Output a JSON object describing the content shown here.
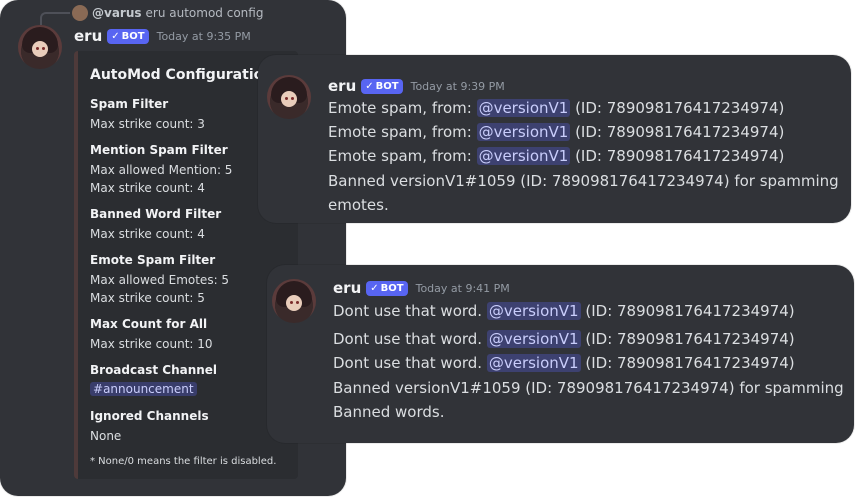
{
  "config_message": {
    "reply": {
      "user": "@varus",
      "text": "eru automod config"
    },
    "author": "eru",
    "bot_badge": "BOT",
    "timestamp": "Today at 9:35 PM",
    "embed": {
      "title": "AutoMod Configuration",
      "fields": [
        {
          "name": "Spam Filter",
          "values": [
            "Max strike count: 3"
          ]
        },
        {
          "name": "Mention Spam Filter",
          "values": [
            "Max allowed Mention: 5",
            "Max strike count: 4"
          ]
        },
        {
          "name": "Banned Word Filter",
          "values": [
            "Max strike count: 4"
          ]
        },
        {
          "name": "Emote Spam Filter",
          "values": [
            "Max allowed Emotes: 5",
            "Max strike count: 5"
          ]
        },
        {
          "name": "Max Count for All",
          "values": [
            "Max strike count: 10"
          ]
        },
        {
          "name": "Broadcast Channel",
          "channel": "announcement"
        },
        {
          "name": "Ignored Channels",
          "values": [
            "None"
          ]
        }
      ],
      "footer": "* None/0 means the filter is disabled."
    }
  },
  "emote_message": {
    "author": "eru",
    "bot_badge": "BOT",
    "timestamp": "Today at 9:39 PM",
    "lines": [
      {
        "prefix": "Emote spam, from: ",
        "mention": "@versionV1",
        "suffix": " (ID: 789098176417234974)"
      },
      {
        "prefix": "Emote spam, from: ",
        "mention": "@versionV1",
        "suffix": " (ID: 789098176417234974)"
      },
      {
        "prefix": "Emote spam, from: ",
        "mention": "@versionV1",
        "suffix": " (ID: 789098176417234974)"
      }
    ],
    "ban_line1": "Banned versionV1#1059 (ID: 789098176417234974) for spamming",
    "ban_line2": "emotes."
  },
  "word_message": {
    "author": "eru",
    "bot_badge": "BOT",
    "timestamp": "Today at 9:41 PM",
    "lines": [
      {
        "prefix": "Dont use that word. ",
        "mention": "@versionV1",
        "suffix": " (ID: 789098176417234974)"
      },
      {
        "prefix": "Dont use that word. ",
        "mention": "@versionV1",
        "suffix": " (ID: 789098176417234974)"
      },
      {
        "prefix": "Dont use that word. ",
        "mention": "@versionV1",
        "suffix": " (ID: 789098176417234974)"
      }
    ],
    "ban_line1": "Banned versionV1#1059 (ID: 789098176417234974) for spamming",
    "ban_line2": "Banned words."
  },
  "colors": {
    "background": "#313338",
    "embed": "#2b2d31",
    "mention_bg": "#3c4270",
    "bot_badge": "#5865f2"
  }
}
